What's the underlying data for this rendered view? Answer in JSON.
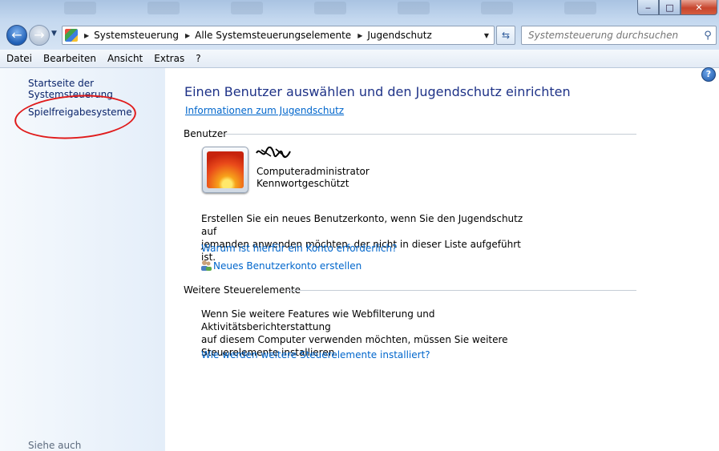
{
  "window": {
    "title_buttons": {
      "minimize": "‒",
      "maximize": "□",
      "close": "✕"
    }
  },
  "address_bar": {
    "crumbs": [
      "Systemsteuerung",
      "Alle Systemsteuerungselemente",
      "Jugendschutz"
    ]
  },
  "search": {
    "placeholder": "Systemsteuerung durchsuchen"
  },
  "menu": [
    "Datei",
    "Bearbeiten",
    "Ansicht",
    "Extras",
    "?"
  ],
  "sidebar": {
    "home_link": "Startseite der Systemsteuerung",
    "game_ratings_link": "Spielfreigabesysteme",
    "see_also": "Siehe auch"
  },
  "main": {
    "title": "Einen Benutzer auswählen und den Jugendschutz einrichten",
    "info_link": "Informationen zum Jugendschutz",
    "users_section": {
      "heading": "Benutzer",
      "user": {
        "role": "Computeradministrator",
        "password_status": "Kennwortgeschützt"
      },
      "new_account_text_line1": "Erstellen Sie ein neues Benutzerkonto, wenn Sie den Jugendschutz auf",
      "new_account_text_line2": "jemanden anwenden möchten, der nicht in dieser Liste aufgeführt ist.",
      "why_link": "Warum ist hierfür ein Konto erforderlich?",
      "create_link": "Neues Benutzerkonto erstellen"
    },
    "controls_section": {
      "heading": "Weitere Steuerelemente",
      "text_line1": "Wenn Sie weitere Features wie Webfilterung und Aktivitätsberichterstattung",
      "text_line2": "auf diesem Computer verwenden möchten, müssen Sie weitere",
      "text_line3": "Steuerelemente installieren.",
      "how_link": "Wie werden weitere Steuerelemente installiert?"
    }
  },
  "colors": {
    "link": "#0066cc",
    "title": "#1e3287",
    "annotation_circle": "#e01b1b"
  }
}
